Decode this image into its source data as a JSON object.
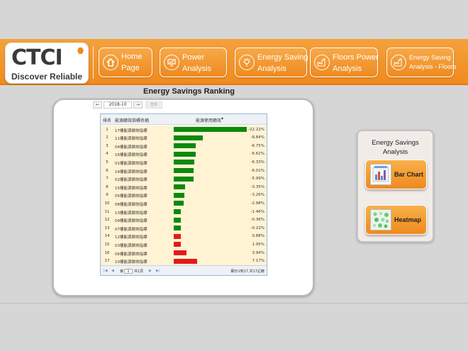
{
  "brand": {
    "name": "CTCI",
    "tagline": "Discover Reliable",
    "accent": "#f08a1e"
  },
  "nav": [
    {
      "label": "Home\nPage",
      "icon": "home-icon"
    },
    {
      "label": "Power\nAnalysis",
      "icon": "presentation-chart-icon"
    },
    {
      "label": "Energy Saving\nAnalysis",
      "icon": "lightbulb-icon"
    },
    {
      "label": "Floors Power\nAnalysis",
      "icon": "factory-icon"
    },
    {
      "label": "Energy Saving\nAnalysis - Floors",
      "icon": "factory-icon"
    }
  ],
  "main": {
    "title": "Energy Savings Ranking",
    "date": {
      "prev": "←",
      "value": "2018-10",
      "next": "→",
      "query": "查詢"
    },
    "table": {
      "headers": {
        "rank": "排名",
        "name": "能源績效指標名稱",
        "value": "能源使用績效"
      },
      "rows": [
        {
          "rank": "1",
          "name": "17樓能源績效指標",
          "value": "-22.22%",
          "pct": -22.22
        },
        {
          "rank": "2",
          "name": "11樓能源績效指標",
          "value": "-8.84%",
          "pct": -8.84
        },
        {
          "rank": "3",
          "name": "04樓能源績效指標",
          "value": "-6.75%",
          "pct": -6.75
        },
        {
          "rank": "4",
          "name": "16樓能源績效指標",
          "value": "-6.62%",
          "pct": -6.62
        },
        {
          "rank": "5",
          "name": "01樓能源績效指標",
          "value": "-6.33%",
          "pct": -6.33
        },
        {
          "rank": "6",
          "name": "14樓能源績效指標",
          "value": "-6.01%",
          "pct": -6.01
        },
        {
          "rank": "7",
          "name": "02樓能源績效指標",
          "value": "-5.99%",
          "pct": -5.99
        },
        {
          "rank": "8",
          "name": "15樓能源績效指標",
          "value": "-3.35%",
          "pct": -3.35
        },
        {
          "rank": "9",
          "name": "05樓能源績效指標",
          "value": "-3.26%",
          "pct": -3.26
        },
        {
          "rank": "10",
          "name": "08樓能源績效指標",
          "value": "-2.98%",
          "pct": -2.98
        },
        {
          "rank": "11",
          "name": "13樓能源績效指標",
          "value": "-1.46%",
          "pct": -1.46
        },
        {
          "rank": "12",
          "name": "09樓能源績效指標",
          "value": "-0.36%",
          "pct": -0.36
        },
        {
          "rank": "13",
          "name": "07樓能源績效指標",
          "value": "-0.22%",
          "pct": -0.22
        },
        {
          "rank": "14",
          "name": "12樓能源績效指標",
          "value": "0.88%",
          "pct": 0.88
        },
        {
          "rank": "15",
          "name": "03樓能源績效指標",
          "value": "1.95%",
          "pct": 1.95
        },
        {
          "rank": "16",
          "name": "06樓能源績效指標",
          "value": "3.94%",
          "pct": 3.94
        },
        {
          "rank": "17",
          "name": "10樓能源績效指標",
          "value": "7.17%",
          "pct": 7.17
        }
      ],
      "bar_colors": {
        "saving": "#0a8a0a",
        "increase": "#e41a1a"
      },
      "pager": {
        "first": "|◀",
        "prev": "◀",
        "page_prefix": "第",
        "page_value": "1",
        "page_suffix": "共1頁",
        "next": "▶",
        "last": "▶|",
        "summary": "顯示1到17,共17記錄"
      }
    }
  },
  "side_panel": {
    "title": "Energy Savings\nAnalysis",
    "buttons": [
      {
        "label": "Bar Chart",
        "icon": "bar-chart-icon"
      },
      {
        "label": "Heatmap",
        "icon": "heatmap-icon"
      }
    ]
  }
}
